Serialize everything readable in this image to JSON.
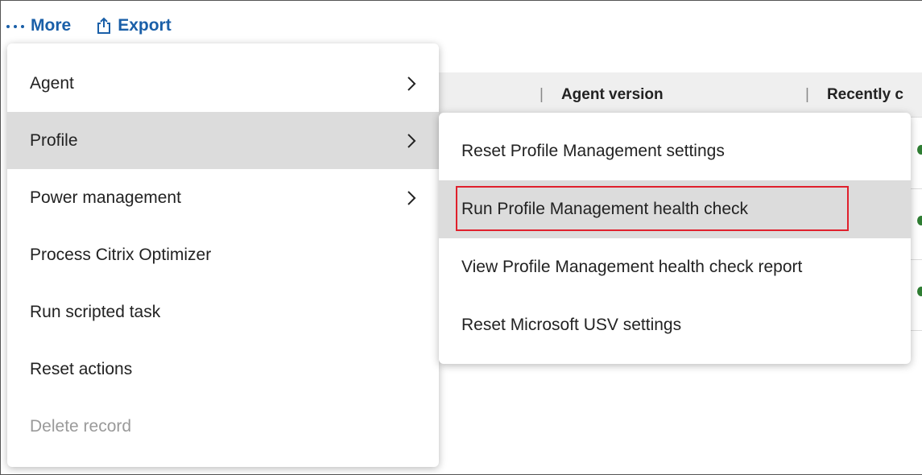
{
  "toolbar": {
    "more_label": "More",
    "export_label": "Export"
  },
  "table": {
    "columns": [
      "Agent version",
      "Recently c"
    ]
  },
  "main_menu": {
    "items": [
      {
        "label": "Agent",
        "has_submenu": true,
        "state": "normal"
      },
      {
        "label": "Profile",
        "has_submenu": true,
        "state": "active"
      },
      {
        "label": "Power management",
        "has_submenu": true,
        "state": "normal"
      },
      {
        "label": "Process Citrix Optimizer",
        "has_submenu": false,
        "state": "normal"
      },
      {
        "label": "Run scripted task",
        "has_submenu": false,
        "state": "normal"
      },
      {
        "label": "Reset actions",
        "has_submenu": false,
        "state": "normal"
      },
      {
        "label": "Delete record",
        "has_submenu": false,
        "state": "disabled"
      }
    ]
  },
  "sub_menu": {
    "items": [
      {
        "label": "Reset Profile Management settings"
      },
      {
        "label": "Run Profile Management health check",
        "highlighted": true
      },
      {
        "label": "View Profile Management health check report"
      },
      {
        "label": "Reset Microsoft USV settings"
      }
    ]
  },
  "colors": {
    "link": "#1a5fa8",
    "active_bg": "#dcdcdc",
    "highlight_border": "#e0202c",
    "disabled_text": "#9a9a9a"
  }
}
